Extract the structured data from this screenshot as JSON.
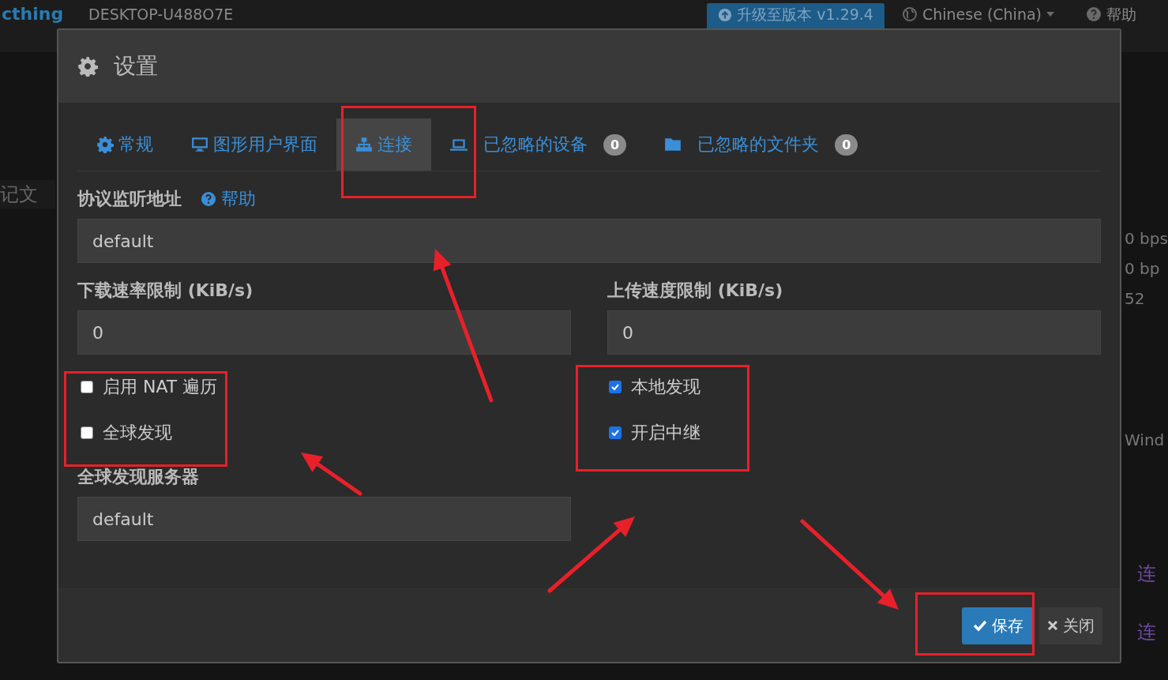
{
  "background": {
    "brand": "cthing",
    "device": "DESKTOP-U488O7E",
    "upgrade_button": "升级至版本 v1.29.4",
    "language": "Chinese (China)",
    "help": "帮助",
    "left_texts": [
      "记文"
    ],
    "right_texts": [
      "0 bps",
      "0 bp",
      "52",
      "Wind"
    ],
    "right_links": [
      "连",
      "连"
    ]
  },
  "dialog": {
    "title": "设置",
    "tabs": [
      {
        "label": "常规",
        "selected": false
      },
      {
        "label": "图形用户界面",
        "selected": false
      },
      {
        "label": "连接",
        "selected": true
      },
      {
        "label": "已忽略的设备",
        "badge": "0",
        "selected": false
      },
      {
        "label": "已忽略的文件夹",
        "badge": "0",
        "selected": false
      }
    ],
    "listen_address": {
      "label": "协议监听地址",
      "help": "帮助",
      "value": "default"
    },
    "download_limit": {
      "label": "下载速率限制 (KiB/s)",
      "value": "0"
    },
    "upload_limit": {
      "label": "上传速度限制 (KiB/s)",
      "value": "0"
    },
    "left_checks": [
      {
        "label": "启用 NAT 遍历",
        "checked": false
      },
      {
        "label": "全球发现",
        "checked": false
      }
    ],
    "right_checks": [
      {
        "label": "本地发现",
        "checked": true
      },
      {
        "label": "开启中继",
        "checked": true
      }
    ],
    "discovery_server": {
      "label": "全球发现服务器",
      "value": "default"
    },
    "save_button": "保存",
    "close_button": "关闭"
  }
}
